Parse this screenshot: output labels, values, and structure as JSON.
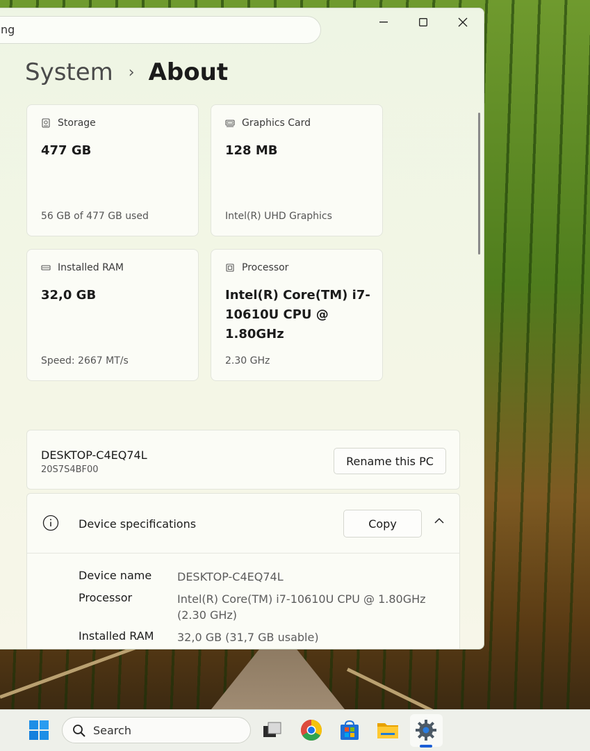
{
  "window": {
    "search_value": "ng",
    "breadcrumb": {
      "parent": "System",
      "separator": "›",
      "current": "About"
    }
  },
  "cards": [
    {
      "id": "storage",
      "label": "Storage",
      "icon": "storage-icon",
      "value": "477 GB",
      "sub": "56 GB of 477 GB used"
    },
    {
      "id": "graphics",
      "label": "Graphics Card",
      "icon": "graphics-card-icon",
      "value": "128 MB",
      "sub": "Intel(R) UHD Graphics"
    },
    {
      "id": "ram",
      "label": "Installed RAM",
      "icon": "ram-icon",
      "value": "32,0 GB",
      "sub": "Speed: 2667 MT/s"
    },
    {
      "id": "processor",
      "label": "Processor",
      "icon": "processor-icon",
      "value": "Intel(R) Core(TM) i7-10610U CPU @ 1.80GHz",
      "sub": "2.30 GHz"
    }
  ],
  "pc": {
    "name": "DESKTOP-C4EQ74L",
    "model": "20S7S4BF00",
    "rename_label": "Rename this PC"
  },
  "specs": {
    "title": "Device specifications",
    "copy_label": "Copy",
    "rows": [
      {
        "label": "Device name",
        "value": "DESKTOP-C4EQ74L"
      },
      {
        "label": "Processor",
        "value": "Intel(R) Core(TM) i7-10610U CPU @ 1.80GHz (2.30 GHz)"
      },
      {
        "label": "Installed RAM",
        "value": "32,0 GB (31,7 GB usable)"
      }
    ]
  },
  "taskbar": {
    "search_placeholder": "Search"
  },
  "colors": {
    "accent": "#1a5ed6",
    "window_bg": "#f4f6e6",
    "card_bg": "#fbfcf6"
  }
}
